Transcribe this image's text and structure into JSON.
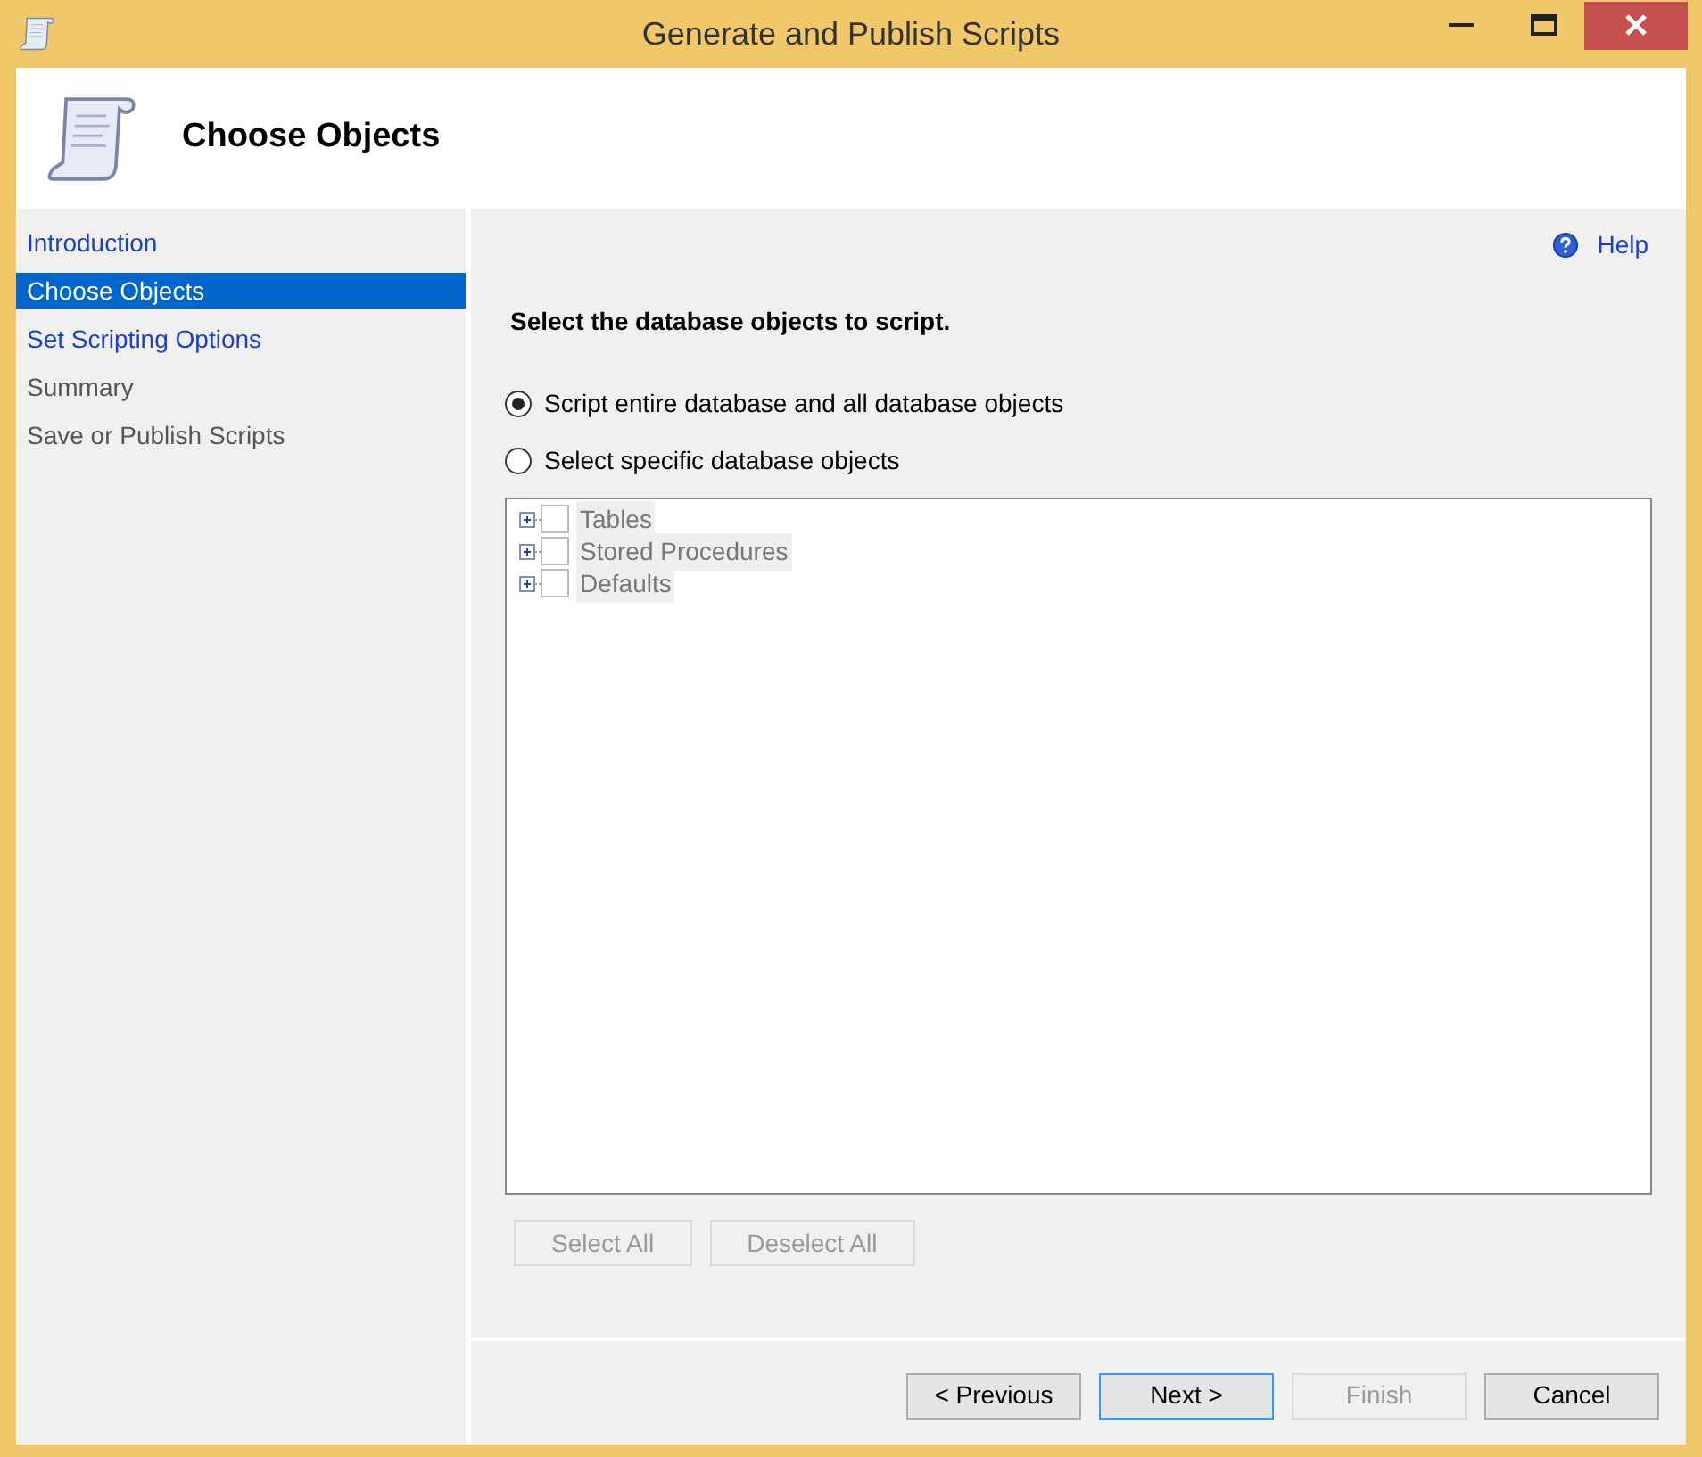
{
  "window": {
    "title": "Generate and Publish Scripts"
  },
  "header": {
    "title": "Choose Objects"
  },
  "sidebar": {
    "items": [
      {
        "label": "Introduction",
        "selected": false,
        "enabled": true
      },
      {
        "label": "Choose Objects",
        "selected": true,
        "enabled": true
      },
      {
        "label": "Set Scripting Options",
        "selected": false,
        "enabled": true
      },
      {
        "label": "Summary",
        "selected": false,
        "enabled": false
      },
      {
        "label": "Save or Publish Scripts",
        "selected": false,
        "enabled": false
      }
    ]
  },
  "help": {
    "label": "Help"
  },
  "heading": "Select the database objects to script.",
  "options": [
    {
      "label": "Script entire database and all database objects",
      "selected": true
    },
    {
      "label": "Select specific database objects",
      "selected": false
    }
  ],
  "tree": [
    {
      "label": "Tables",
      "checked": false,
      "disabled": true
    },
    {
      "label": "Stored Procedures",
      "checked": false,
      "disabled": true
    },
    {
      "label": "Defaults",
      "checked": false,
      "disabled": true
    }
  ],
  "selection_buttons": [
    {
      "label": "Select All",
      "disabled": true
    },
    {
      "label": "Deselect All",
      "disabled": true
    }
  ],
  "footer_buttons": [
    {
      "label": "< Previous",
      "disabled": false,
      "default": false
    },
    {
      "label": "Next >",
      "disabled": false,
      "default": true
    },
    {
      "label": "Finish",
      "disabled": true,
      "default": false
    },
    {
      "label": "Cancel",
      "disabled": false,
      "default": false
    }
  ]
}
